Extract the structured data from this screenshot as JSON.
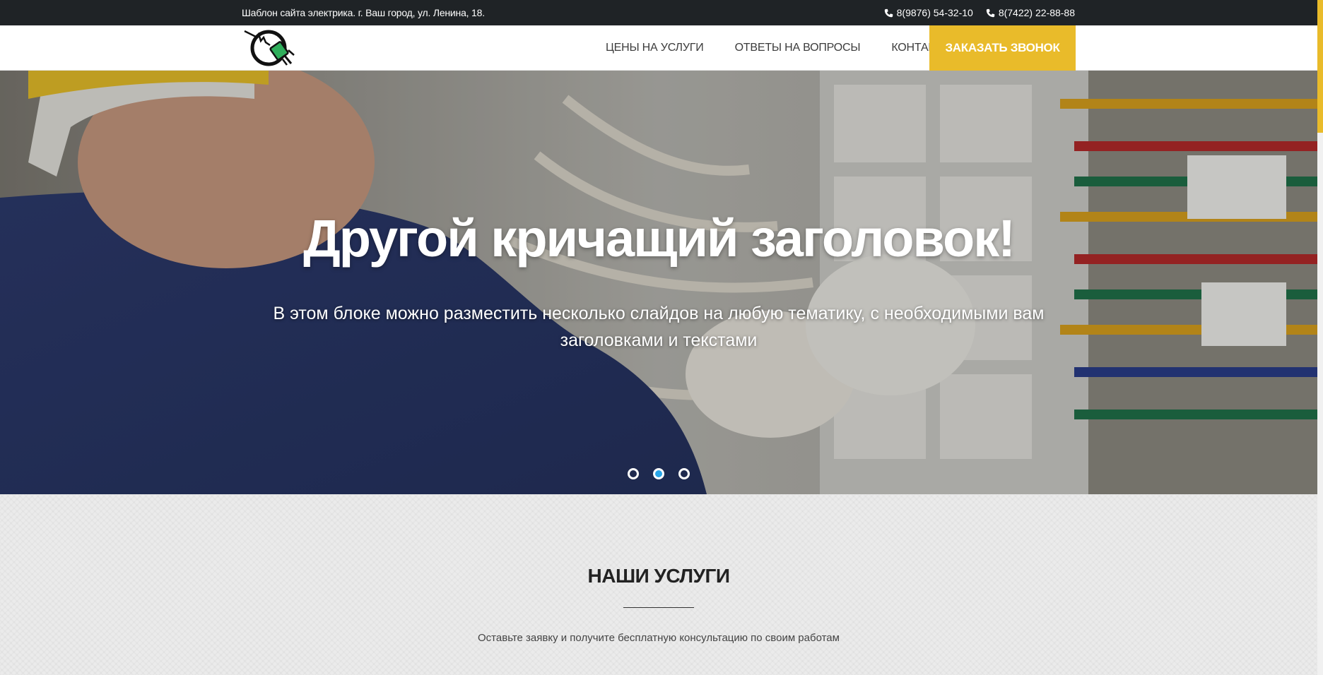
{
  "topbar": {
    "address": "Шаблон сайта электрика. г. Ваш город, ул. Ленина, 18.",
    "phones": [
      "8(9876) 54-32-10",
      "8(7422) 22-88-88"
    ]
  },
  "nav": {
    "items": [
      "ЦЕНЫ НА УСЛУГИ",
      "ОТВЕТЫ НА ВОПРОСЫ",
      "КОНТАКТЫ"
    ],
    "cta": "ЗАКАЗАТЬ ЗВОНОК"
  },
  "hero": {
    "title": "Другой кричащий заголовок!",
    "text": "В этом блоке можно разместить несколько слайдов на любую тематику, с необходимыми вам заголовками и текстами",
    "slide_count": 3,
    "active_slide": 2
  },
  "services": {
    "title": "НАШИ УСЛУГИ",
    "subtitle": "Оставьте заявку и получите бесплатную консультацию по своим работам"
  },
  "colors": {
    "topbar_bg": "#1f2326",
    "accent": "#e9bb2a",
    "dot_active": "#29a6e8"
  }
}
